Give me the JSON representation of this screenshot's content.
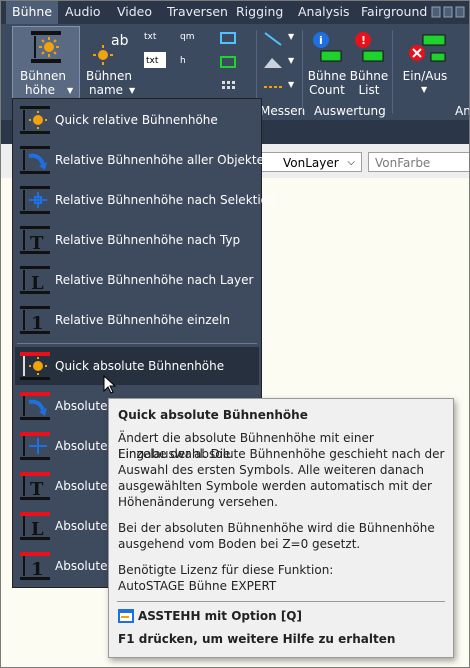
{
  "tabs": [
    "Bühne",
    "Audio",
    "Video",
    "Traversen",
    "Rigging",
    "Analysis",
    "Fairground"
  ],
  "ribbon": {
    "buehnenhoehe_line1": "Bühnen",
    "buehnenhoehe_line2": "höhe",
    "buehnenname_line1": "Bühnen",
    "buehnenname_line2": "name",
    "small_txt": "txt",
    "small_qm": "qm",
    "small_h": "h",
    "count_line1": "Bühne",
    "count_line2": "Count",
    "list_line1": "Bühne",
    "list_line2": "List",
    "einaus": "Ein/Aus",
    "group_messen": "Messen",
    "group_auswertung": "Auswertung",
    "group_an": "An"
  },
  "propbar": {
    "layer_value": "VonLayer",
    "color_value": "VonFarbe"
  },
  "menu": {
    "items": [
      "Quick relative Bühnenhöhe",
      "Relative Bühnenhöhe aller Objekte",
      "Relative Bühnenhöhe nach Selektion",
      "Relative Bühnenhöhe nach Typ",
      "Relative Bühnenhöhe nach Layer",
      "Relative Bühnenhöhe einzeln",
      "Quick absolute Bühnenhöhe",
      "Absolute B",
      "Absolute B",
      "Absolute B",
      "Absolute B",
      "Absolute B"
    ]
  },
  "tooltip": {
    "title": "Quick absolute Bühnenhöhe",
    "p1_l1": "Ändert die absolute Bühnenhöhe mit einer Einzelauswahl. Die",
    "p1_l2": "Eingabe der absolute Bühnenhöhe geschieht nach der",
    "p1_l3": "Auswahl des ersten Symbols. Alle weiteren danach",
    "p1_l4": "ausgewählten Symbole werden automatisch mit der",
    "p1_l5": "Höhenänderung versehen.",
    "p2_l1": "Bei der absoluten Bühnenhöhe wird die Bühnenhöhe",
    "p2_l2": "ausgehend vom Boden bei Z=0 gesetzt.",
    "p3_l1": "Benötigte Lizenz für diese Funktion:",
    "p3_l2": "AutoSTAGE Bühne EXPERT",
    "command": "ASSTEHH mit Option [Q]",
    "help": "F1 drücken, um weitere Hilfe zu erhalten"
  },
  "colors": {
    "tabbar": "#2b3648",
    "ribbon": "#3c4a60",
    "menu": "#3e4a5e",
    "accent_red": "#e8101a",
    "accent_green": "#1fd32f",
    "sun": "#f2a20c"
  }
}
